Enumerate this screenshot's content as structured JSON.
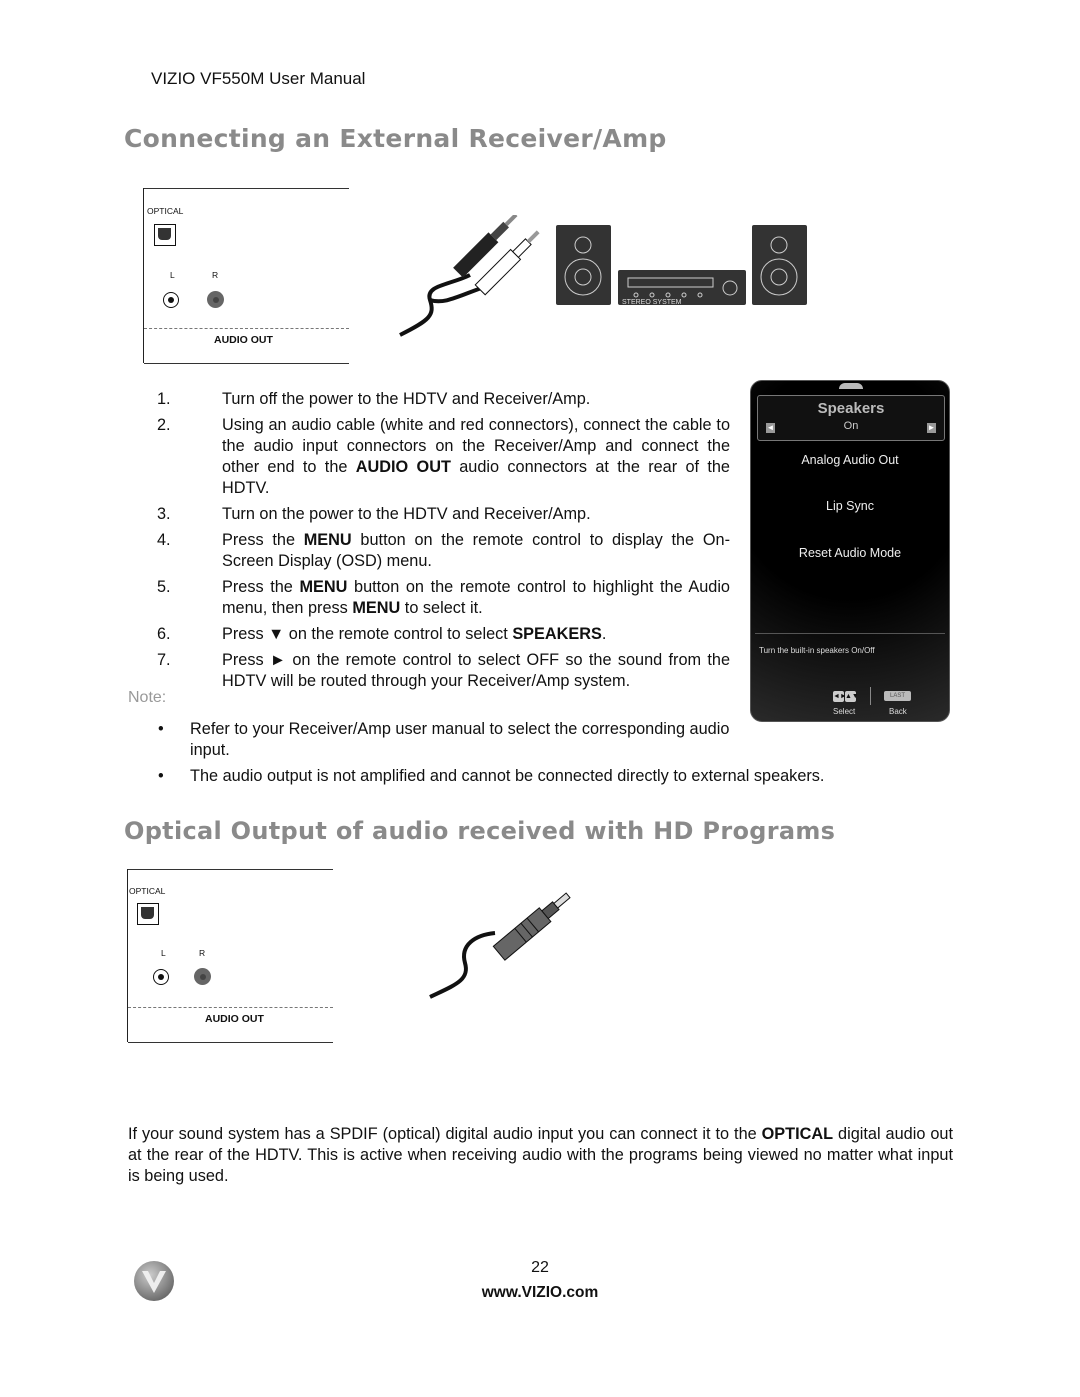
{
  "header": {
    "running_title": "VIZIO VF550M User Manual"
  },
  "section1": {
    "title": "Connecting an External Receiver/Amp",
    "panel": {
      "optical_label": "OPTICAL",
      "left_label": "L",
      "right_label": "R",
      "audio_out_label": "AUDIO OUT"
    },
    "stereo_label": "STEREO SYSTEM",
    "steps": [
      {
        "num": "1.",
        "text_parts": [
          "Turn off the power to the HDTV and Receiver/Amp."
        ]
      },
      {
        "num": "2.",
        "pre": "Using an audio cable (white and red connectors), connect the cable to the audio input connectors on the Receiver/Amp and connect the other end to the ",
        "bold": "AUDIO OUT",
        "post": " audio connectors at the rear of the HDTV."
      },
      {
        "num": "3.",
        "text": "Turn on the power to the HDTV and Receiver/Amp."
      },
      {
        "num": "4.",
        "pre": "Press the ",
        "bold": "MENU",
        "post": " button on the remote control to display the On-Screen Display (OSD) menu."
      },
      {
        "num": "5.",
        "pre": "Press the ",
        "bold": "MENU",
        "mid": " button on the remote control to highlight the Audio menu, then press ",
        "bold2": "MENU",
        "post": " to select it."
      },
      {
        "num": "6.",
        "pre": "Press ▼ on the remote control to select ",
        "bold": "SPEAKERS",
        "post": "."
      },
      {
        "num": "7.",
        "text": "Press ► on the remote control to select OFF so the sound from the HDTV will be routed through your Receiver/Amp system."
      }
    ],
    "note_label": "Note:",
    "notes": [
      "Refer to your Receiver/Amp user manual to select the corresponding audio input.",
      "The audio output is not amplified and cannot be connected directly to external speakers."
    ],
    "osd": {
      "header_title": "Speakers",
      "header_value": "On",
      "arrow_left": "◄",
      "arrow_right": "►",
      "items": [
        "Analog Audio Out",
        "Lip Sync",
        "Reset Audio Mode"
      ],
      "help_text": "Turn the built-in speakers On/Off",
      "select_glyphs": [
        "◄►",
        "▲▼"
      ],
      "last_button": "LAST",
      "select_caption": "Select",
      "back_caption": "Back"
    }
  },
  "section2": {
    "title": "Optical Output of audio received with HD Programs",
    "panel": {
      "optical_label": "OPTICAL",
      "left_label": "L",
      "right_label": "R",
      "audio_out_label": "AUDIO OUT"
    },
    "paragraph_pre": "If your sound system has a SPDIF (optical) digital audio input you can connect it to the ",
    "paragraph_bold": "OPTICAL",
    "paragraph_post": " digital audio out at the rear of the HDTV. This is active when receiving audio with the programs being viewed no matter what input is being used."
  },
  "footer": {
    "page_number": "22",
    "url": "www.VIZIO.com"
  }
}
